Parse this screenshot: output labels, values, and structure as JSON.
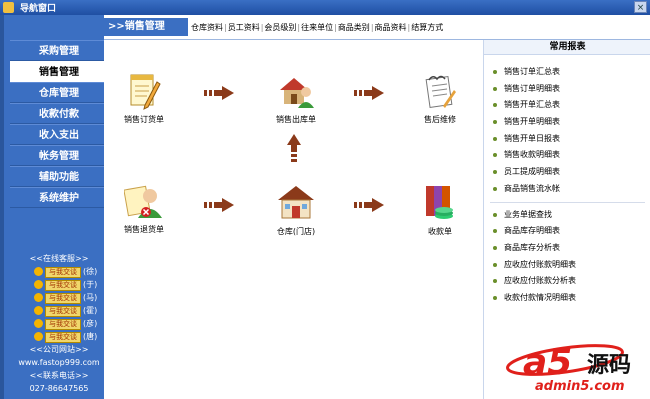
{
  "window": {
    "title": "导航窗口",
    "close_label": "×"
  },
  "sidebar": {
    "items": [
      {
        "label": "采购管理",
        "active": false
      },
      {
        "label": "销售管理",
        "active": true
      },
      {
        "label": "仓库管理",
        "active": false
      },
      {
        "label": "收款付款",
        "active": false
      },
      {
        "label": "收入支出",
        "active": false
      },
      {
        "label": "帐务管理",
        "active": false
      },
      {
        "label": "辅助功能",
        "active": false
      },
      {
        "label": "系统维护",
        "active": false
      }
    ],
    "online_service_title": "<<在线客服>>",
    "qq_button_label": "与我交谈",
    "online_agents": [
      "(徐)",
      "(于)",
      "(马)",
      "(霍)",
      "(彦)",
      "(唐)"
    ],
    "website_title": "<<公司网站>>",
    "website": "www.fastop999.com",
    "phone_title": "<<联系电话>>",
    "phone": "027-86647565"
  },
  "header": {
    "section": ">>销售管理",
    "links": [
      "仓库资料",
      "员工资料",
      "会员级别",
      "往来单位",
      "商品类别",
      "商品资料",
      "结算方式"
    ]
  },
  "flow": {
    "sales_order": "销售订货单",
    "sales_out": "销售出库单",
    "after_sales": "售后维修",
    "sales_return": "销售退货单",
    "warehouse": "仓库(门店)",
    "receipt": "收款单"
  },
  "reports": {
    "title": "常用报表",
    "group1": [
      "销售订单汇总表",
      "销售订单明细表",
      "销售开单汇总表",
      "销售开单明细表",
      "销售开单日报表",
      "销售收款明细表",
      "员工提成明细表",
      "商品销售流水帐"
    ],
    "group2": [
      "业务单据查找",
      "商品库存明细表",
      "商品库存分析表",
      "应收应付账款明细表",
      "应收应付账款分析表",
      "收款付款情况明细表"
    ]
  },
  "watermark": {
    "brand": "a5源码",
    "url": "admin5.com"
  },
  "colors": {
    "sidebar": "#3b6fc2",
    "accent_arrow": "#8b3a1a",
    "watermark_red": "#e0201b"
  }
}
